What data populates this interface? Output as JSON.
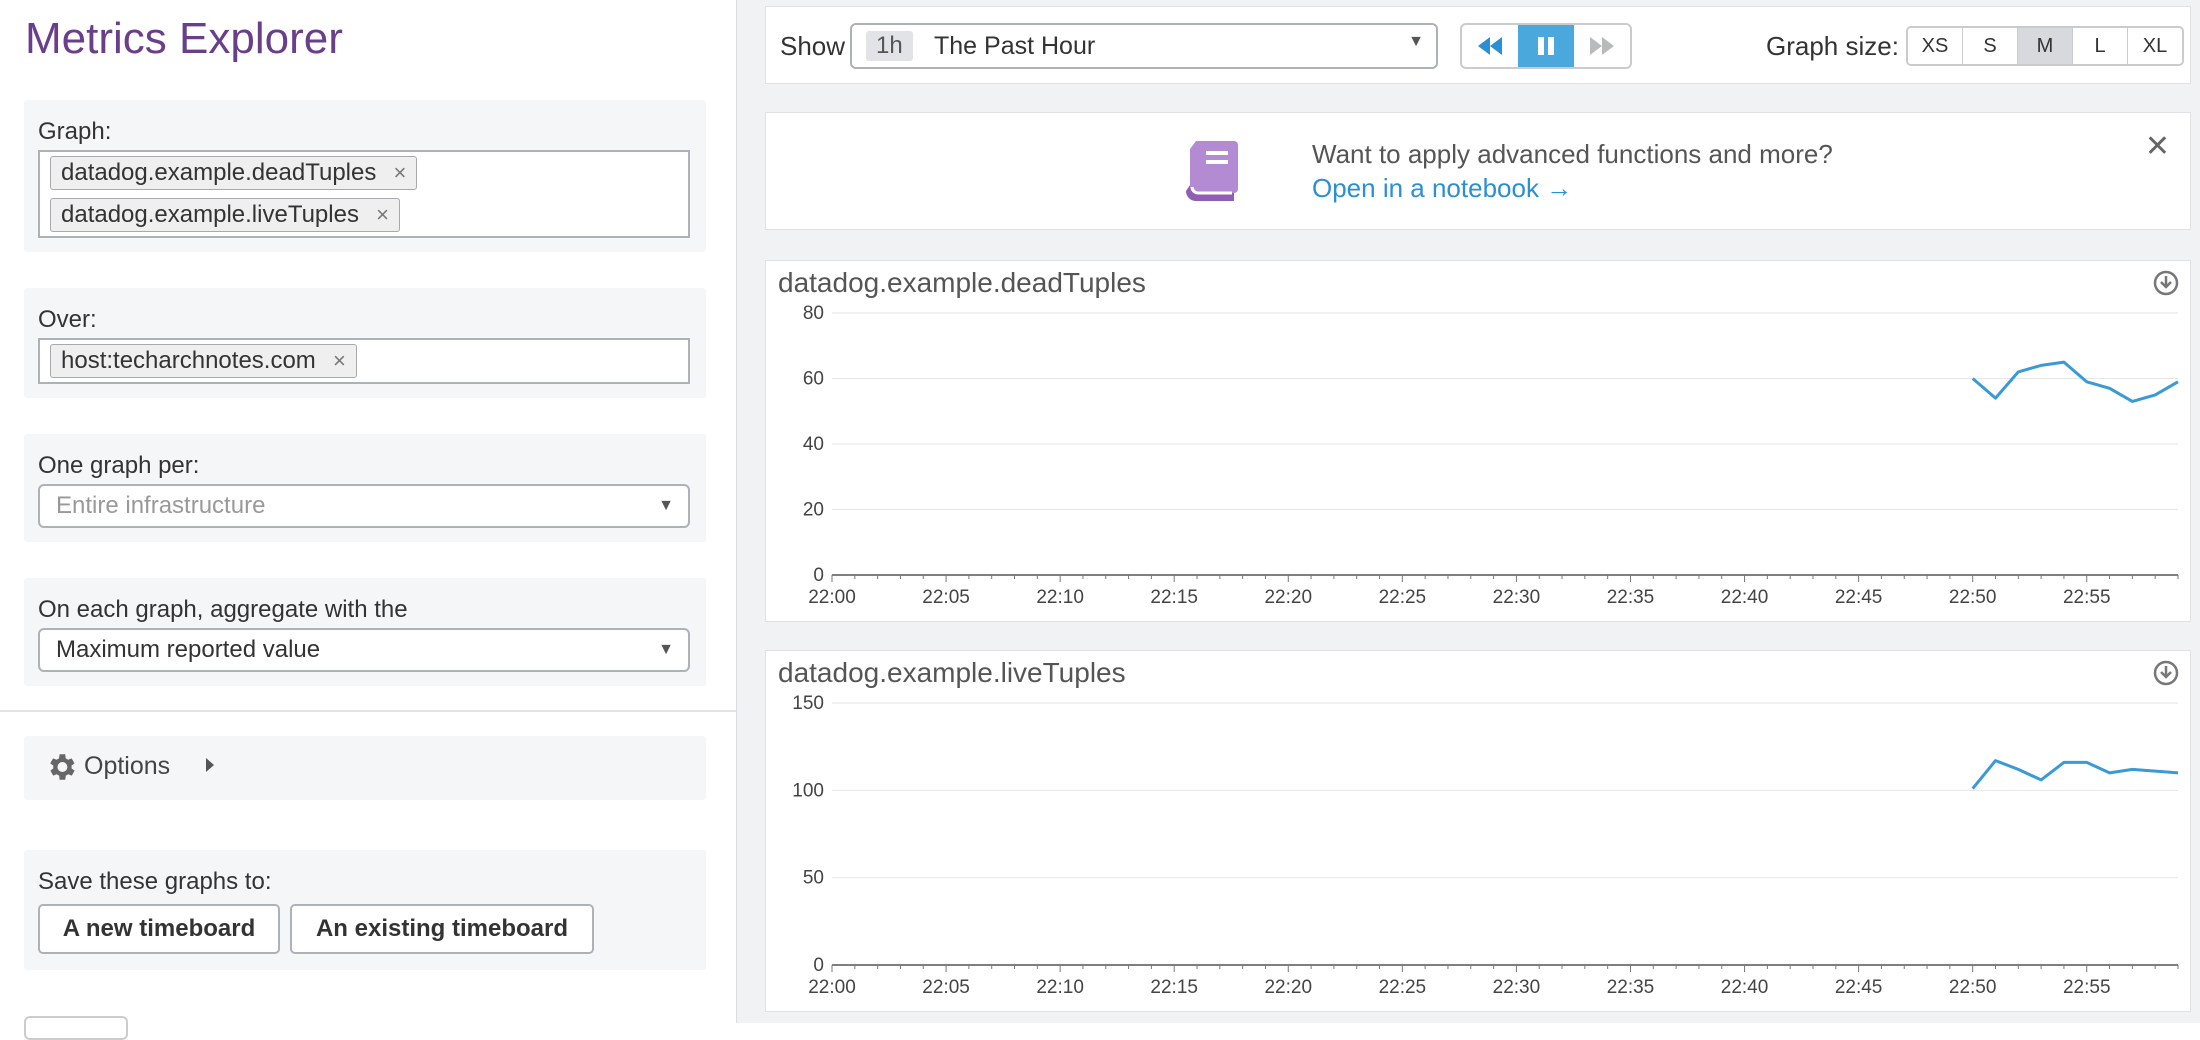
{
  "left": {
    "title": "Metrics Explorer",
    "graph_label": "Graph:",
    "graph_tokens": [
      "datadog.example.deadTuples",
      "datadog.example.liveTuples"
    ],
    "over_label": "Over:",
    "over_tokens": [
      "host:techarchnotes.com"
    ],
    "token_remove": "×",
    "one_graph_label": "One graph per:",
    "one_graph_value": "Entire infrastructure",
    "aggregate_label": "On each graph, aggregate with the",
    "aggregate_value": "Maximum reported value",
    "caret": "▼",
    "options_label": "Options",
    "save_label": "Save these graphs to:",
    "save_new": "A new timeboard",
    "save_existing": "An existing timeboard"
  },
  "toolbar": {
    "show_label": "Show",
    "time_badge": "1h",
    "time_text": "The Past Hour",
    "caret": "▼",
    "graph_size_label": "Graph size:",
    "sizes": [
      "XS",
      "S",
      "M",
      "L",
      "XL"
    ],
    "active_size": "M"
  },
  "banner": {
    "text": "Want to apply advanced functions and more?",
    "link": "Open in a notebook →",
    "close": "✕"
  },
  "colors": {
    "accent": "#4aa8dc",
    "title": "#6a3f8a",
    "line": "#3a9ad6",
    "book": "#a06cc2"
  },
  "chart_data": [
    {
      "type": "line",
      "title": "datadog.example.deadTuples",
      "x_ticks": [
        "22:00",
        "22:05",
        "22:10",
        "22:15",
        "22:20",
        "22:25",
        "22:30",
        "22:35",
        "22:40",
        "22:45",
        "22:50",
        "22:55"
      ],
      "y_ticks": [
        0,
        20,
        40,
        60,
        80
      ],
      "ylim": [
        0,
        80
      ],
      "xlim_min": [
        0,
        59
      ],
      "series": [
        {
          "x": [
            50,
            51,
            52,
            53,
            54,
            55,
            56,
            57,
            58,
            59
          ],
          "y": [
            60,
            54,
            62,
            64,
            65,
            59,
            57,
            53,
            55,
            59
          ]
        }
      ]
    },
    {
      "type": "line",
      "title": "datadog.example.liveTuples",
      "x_ticks": [
        "22:00",
        "22:05",
        "22:10",
        "22:15",
        "22:20",
        "22:25",
        "22:30",
        "22:35",
        "22:40",
        "22:45",
        "22:50",
        "22:55"
      ],
      "y_ticks": [
        0,
        50,
        100,
        150
      ],
      "ylim": [
        0,
        150
      ],
      "xlim_min": [
        0,
        59
      ],
      "series": [
        {
          "x": [
            50,
            51,
            52,
            53,
            54,
            55,
            56,
            57,
            58,
            59
          ],
          "y": [
            101,
            117,
            112,
            106,
            116,
            116,
            110,
            112,
            111,
            110
          ]
        }
      ]
    }
  ]
}
